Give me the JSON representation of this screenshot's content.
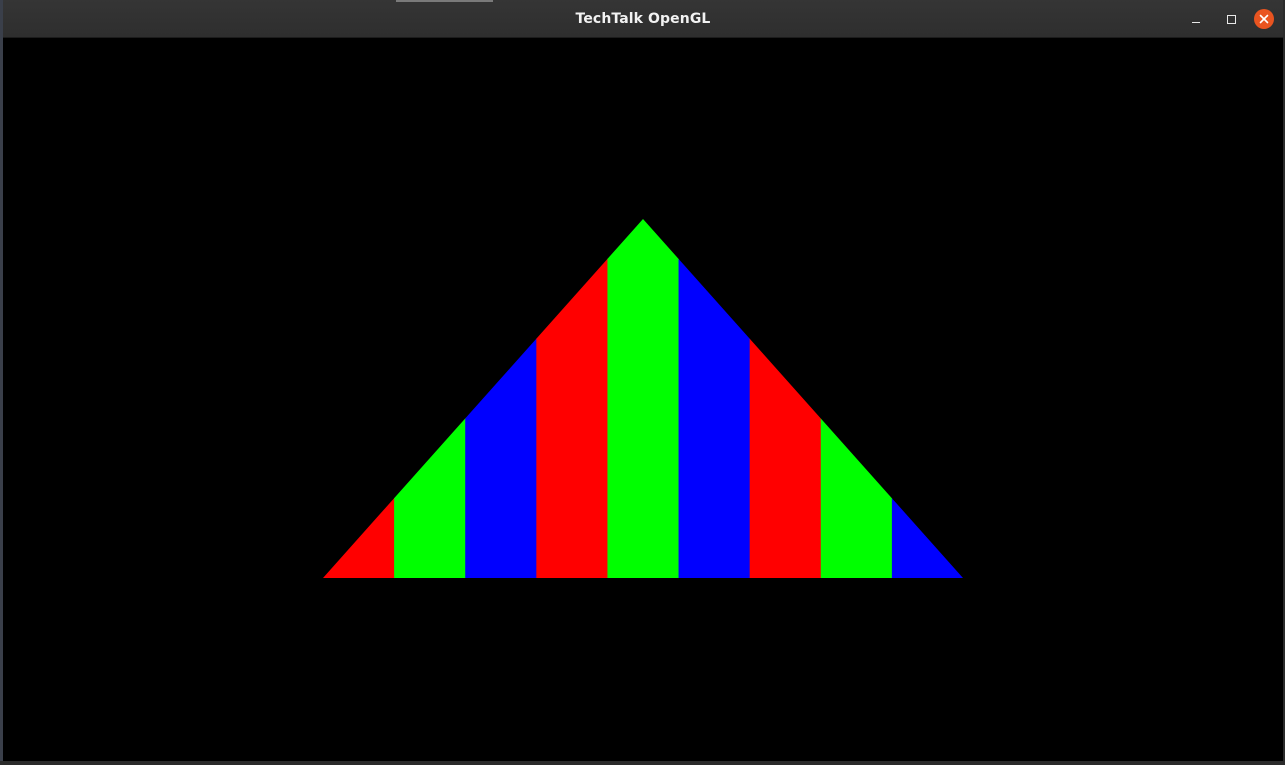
{
  "window": {
    "title": "TechTalk OpenGL",
    "controls": {
      "minimize_icon": "minimize-icon",
      "maximize_icon": "maximize-icon",
      "close_icon": "close-icon",
      "close_color": "#e95420"
    }
  },
  "scene": {
    "background_color": "#000000",
    "stripe_colors": [
      "#ff0000",
      "#00ff00",
      "#0000ff",
      "#ff0000",
      "#00ff00",
      "#0000ff",
      "#ff0000",
      "#00ff00",
      "#0000ff"
    ]
  }
}
